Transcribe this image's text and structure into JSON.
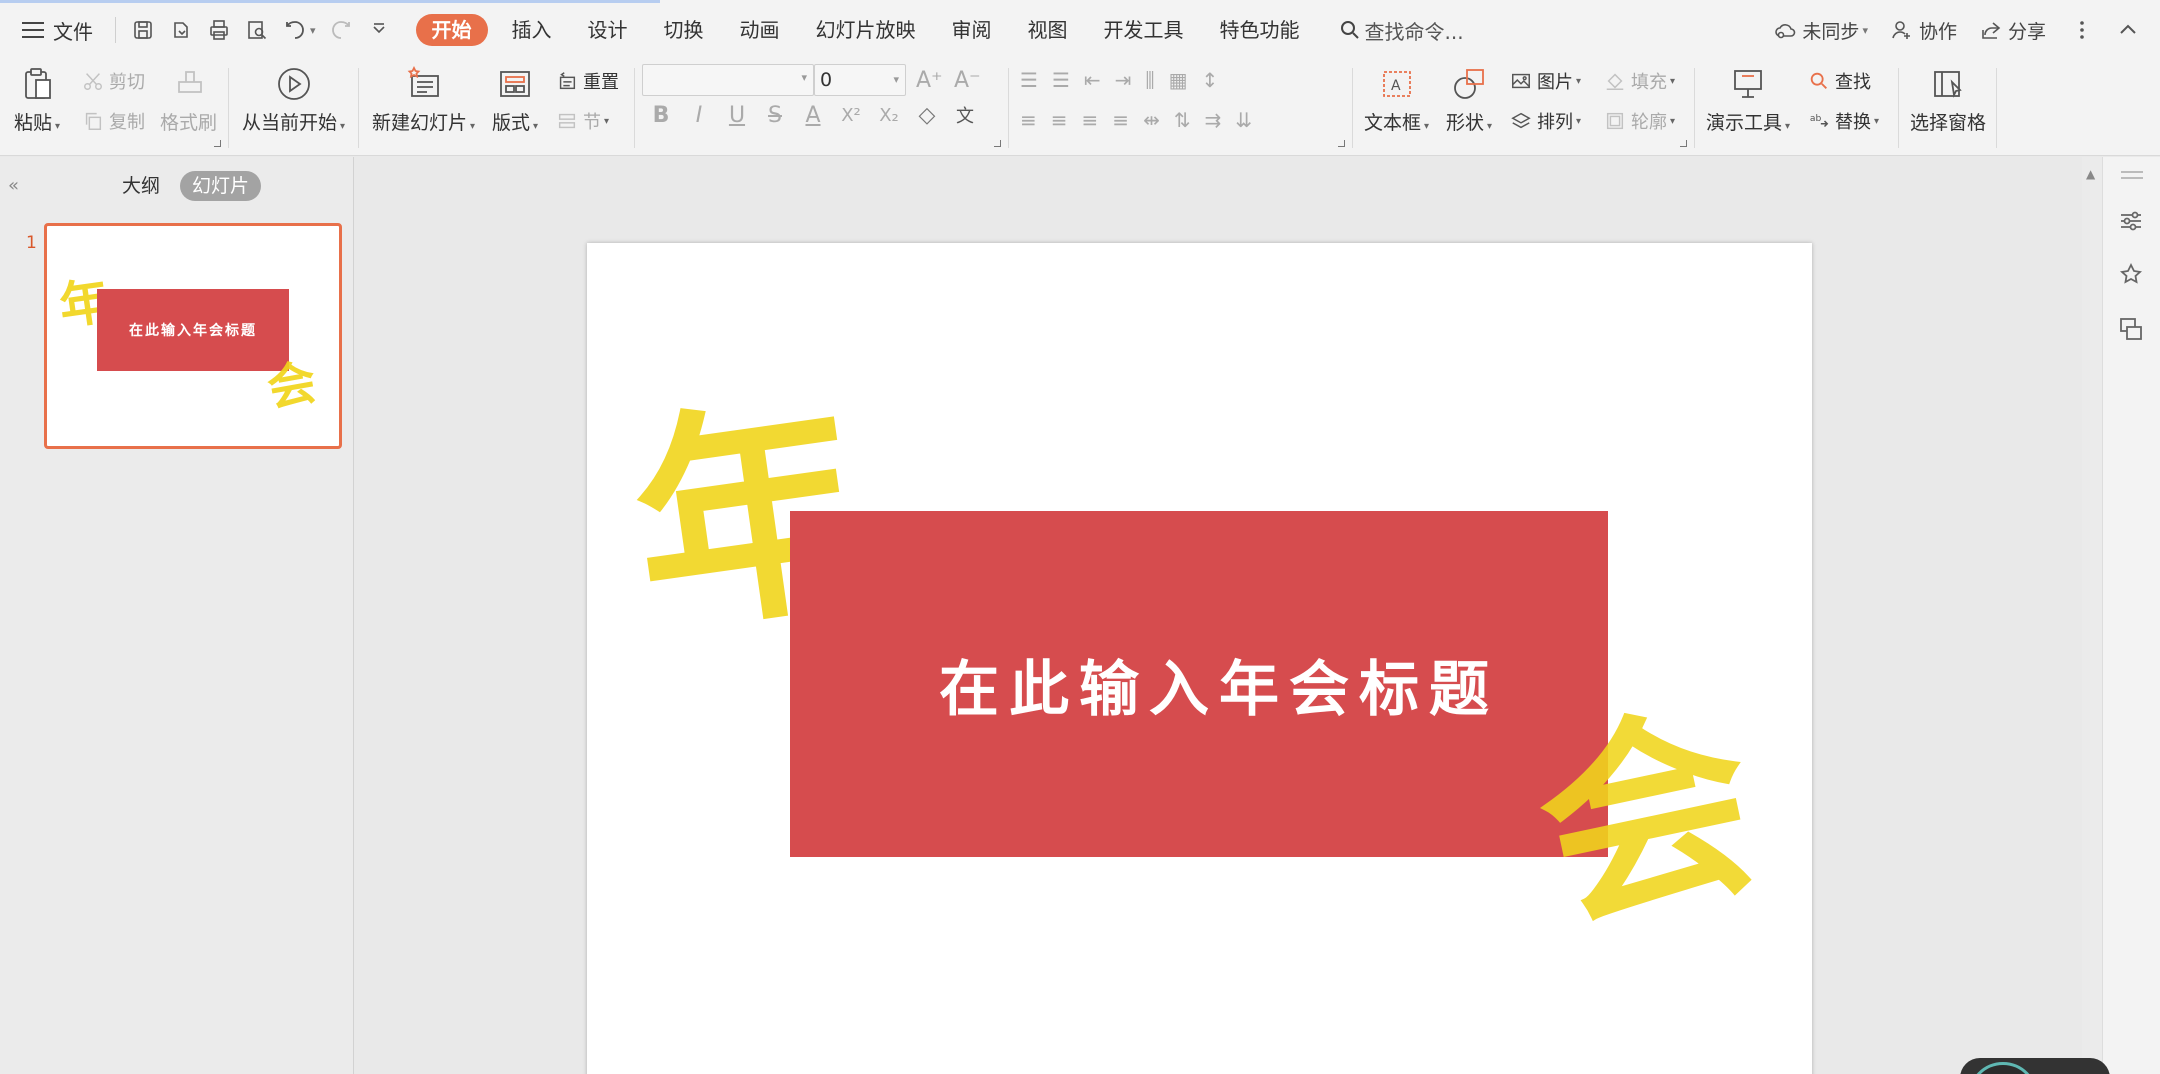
{
  "menubar": {
    "file_label": "文件",
    "tabs": [
      {
        "label": "开始",
        "active": true
      },
      {
        "label": "插入"
      },
      {
        "label": "设计"
      },
      {
        "label": "切换"
      },
      {
        "label": "动画"
      },
      {
        "label": "幻灯片放映"
      },
      {
        "label": "审阅"
      },
      {
        "label": "视图"
      },
      {
        "label": "开发工具"
      },
      {
        "label": "特色功能"
      }
    ],
    "search_label": "查找命令...",
    "sync_label": "未同步",
    "collab_label": "协作",
    "share_label": "分享"
  },
  "ribbon": {
    "paste": "粘贴",
    "cut": "剪切",
    "copy": "复制",
    "format_painter": "格式刷",
    "from_current": "从当前开始",
    "new_slide": "新建幻灯片",
    "layout": "版式",
    "reset": "重置",
    "section": "节",
    "font_size_value": "0",
    "text_box": "文本框",
    "shape": "形状",
    "picture": "图片",
    "fill": "填充",
    "arrange": "排列",
    "outline": "轮廓",
    "presentation_tools": "演示工具",
    "find": "查找",
    "replace": "替换",
    "selection_pane": "选择窗格"
  },
  "left_pane": {
    "tab_outline": "大纲",
    "tab_slides": "幻灯片",
    "thumb_number": "1",
    "thumb_title": "在此输入年会标题",
    "thumb_nian": "年",
    "thumb_hui": "会"
  },
  "slide": {
    "title": "在此输入年会标题",
    "deco_nian": "年",
    "deco_hui": "会"
  },
  "colors": {
    "accent": "#e8704a",
    "slide_red": "#d64c4e",
    "deco_yellow": "#f1d51c"
  }
}
